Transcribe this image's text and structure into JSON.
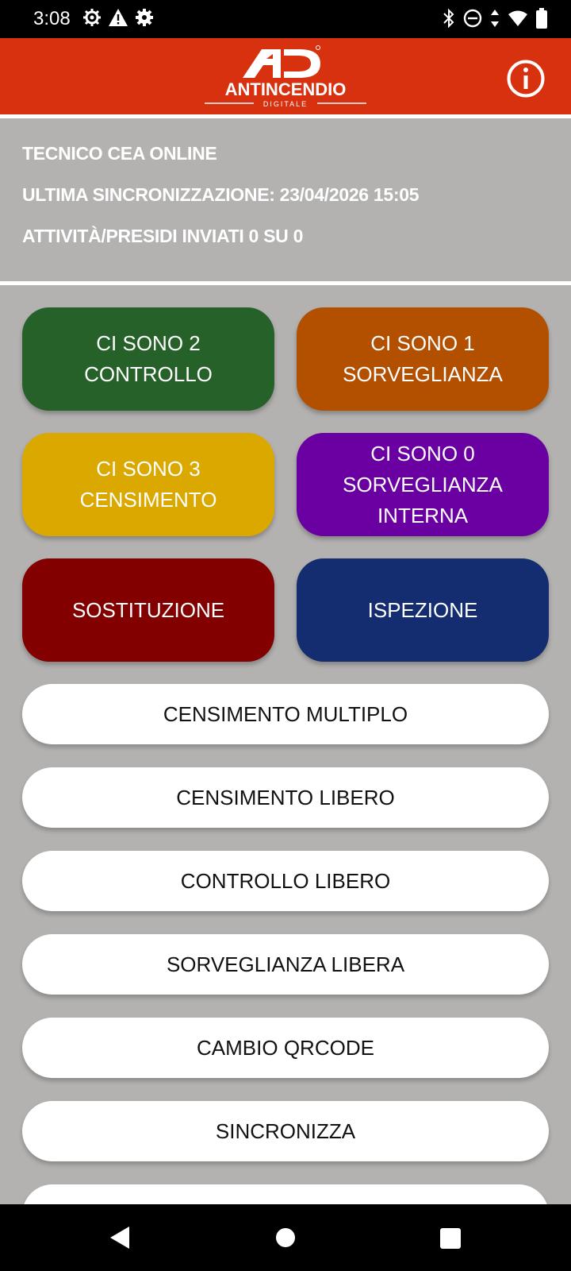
{
  "status_bar": {
    "time": "3:08",
    "left_icons": [
      "gear-outline-icon",
      "warning-icon",
      "settings-icon"
    ],
    "right_icons": [
      "bluetooth-icon",
      "do-not-disturb-icon",
      "data-arrows-icon",
      "wifi-icon",
      "battery-icon"
    ]
  },
  "app_bar": {
    "logo_mark": "AD",
    "logo_name": "ANTINCENDIO",
    "logo_sub": "DIGITALE",
    "info_icon": "info-icon"
  },
  "info_panel": {
    "line1": "TECNICO CEA ONLINE",
    "line2": "ULTIMA SINCRONIZZAZIONE: 23/04/2026 15:05",
    "line3": "ATTIVITÀ/PRESIDI INVIATI 0 SU 0"
  },
  "colored_buttons": [
    {
      "label": "CI SONO 2\nCONTROLLO",
      "color": "#27612a"
    },
    {
      "label": "CI SONO 1\nSORVEGLIANZA",
      "color": "#b25000"
    },
    {
      "label": "CI SONO 3\nCENSIMENTO",
      "color": "#dba800"
    },
    {
      "label": "CI SONO 0\nSORVEGLIANZA\nINTERNA",
      "color": "#6a00a2"
    },
    {
      "label": "SOSTITUZIONE",
      "color": "#830000"
    },
    {
      "label": "ISPEZIONE",
      "color": "#142c70"
    }
  ],
  "white_buttons": [
    {
      "label": "CENSIMENTO MULTIPLO"
    },
    {
      "label": "CENSIMENTO LIBERO"
    },
    {
      "label": "CONTROLLO LIBERO"
    },
    {
      "label": "SORVEGLIANZA LIBERA"
    },
    {
      "label": "CAMBIO QRCODE"
    },
    {
      "label": "SINCRONIZZA"
    },
    {
      "label": ""
    }
  ],
  "nav_bar": {
    "icons": [
      "back-icon",
      "home-icon",
      "recents-icon"
    ]
  },
  "colors": {
    "app_bar": "#d7310f",
    "background": "#b3b2b1"
  }
}
